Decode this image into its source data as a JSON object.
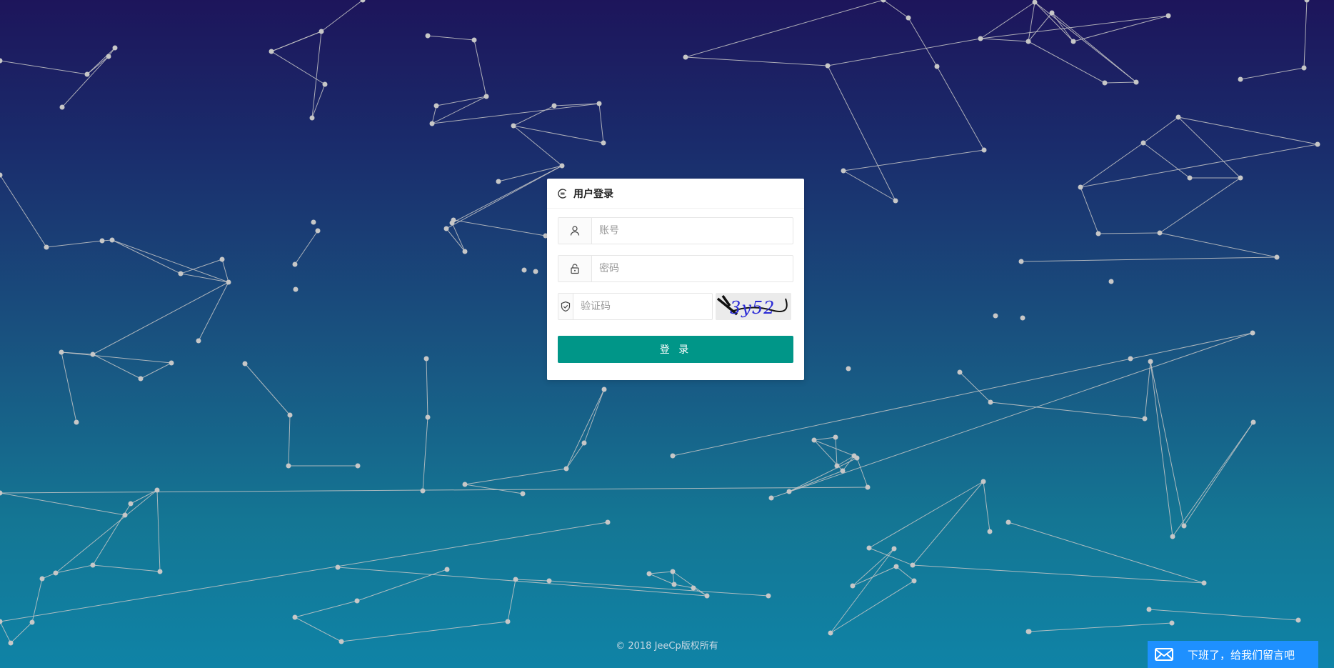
{
  "login": {
    "title": "用户登录",
    "username_placeholder": "账号",
    "password_placeholder": "密码",
    "captcha_placeholder": "验证码",
    "captcha_text": "3y52",
    "submit_label": "登 录"
  },
  "icons": {
    "header": "refresh-icon",
    "username": "user-icon",
    "password": "lock-icon",
    "captcha": "shield-check-icon",
    "message": "mail-icon"
  },
  "footer": {
    "copyright": "© 2018   JeeCp版权所有"
  },
  "message_widget": {
    "label": "下班了，给我们留言吧"
  },
  "colors": {
    "primary_button": "#009688",
    "message_widget": "#1e90ff",
    "bg_top": "#1d155b",
    "bg_bottom": "#0f83a6",
    "particles": "#c7c7c7"
  }
}
